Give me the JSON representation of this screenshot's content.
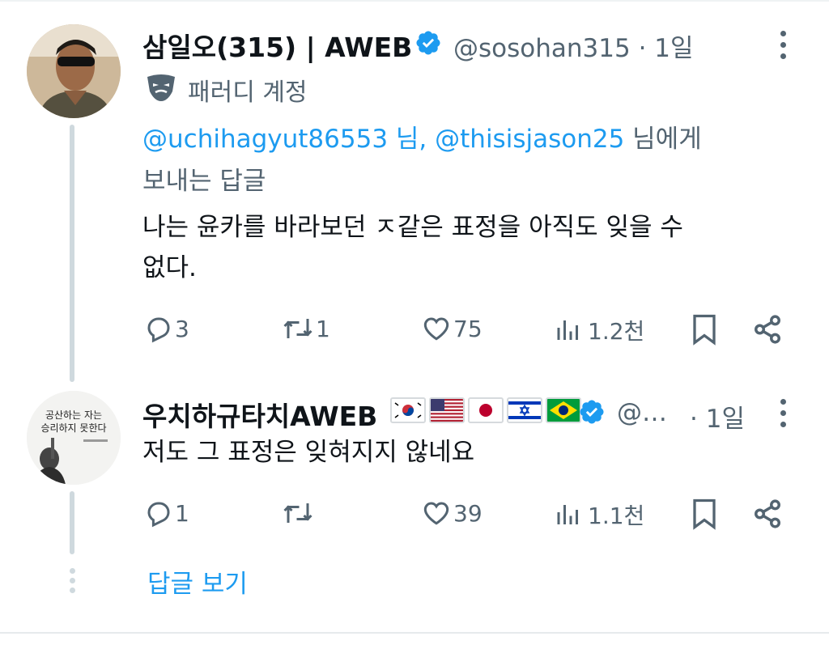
{
  "tweets": [
    {
      "display_name": "삼일오(315) | AWEB",
      "handle": "@sosohan315",
      "separator": "·",
      "time": "1일",
      "badge_icon": "verified-badge-icon",
      "account_label": "패러디 계정",
      "account_label_icon": "parody-mask-icon",
      "reply_mention_1": "@uchihagyut86553",
      "reply_mid_1": " 님, ",
      "reply_mention_2": "@thisisjason25",
      "reply_end": " 님에게",
      "reply_line2": "보내는 답글",
      "text_line1": "나는 윤카를 바라보던 ㅈ같은 표정을 아직도 잊을 수",
      "text_line2": "없다.",
      "stats": {
        "replies": "3",
        "reposts": "1",
        "likes": "75",
        "views": "1.2천"
      }
    },
    {
      "display_name": "우치하규타치AWEB",
      "flags": [
        "korea-flag",
        "usa-flag",
        "japan-flag",
        "israel-flag",
        "brazil-flag"
      ],
      "handle": "@…",
      "separator": "·",
      "time": "1일",
      "badge_icon": "verified-badge-icon",
      "avatar_book_title_1": "공산하는 자는",
      "avatar_book_title_2": "승리하지 못한다",
      "text_line1": "저도 그 표정은 잊혀지지 않네요",
      "stats": {
        "replies": "1",
        "reposts": "",
        "likes": "39",
        "views": "1.1천"
      }
    }
  ],
  "show_replies": "답글 보기",
  "colors": {
    "accent": "#1d9bf0",
    "secondary_text": "#536471",
    "primary_text": "#0f1419",
    "thread_line": "#cfd9de"
  }
}
